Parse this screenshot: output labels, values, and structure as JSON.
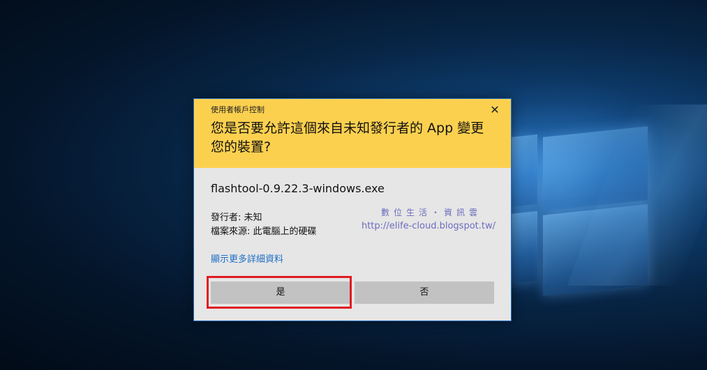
{
  "dialog": {
    "caption": "使用者帳戶控制",
    "close_symbol": "✕",
    "title": "您是否要允許這個來自未知發行者的 App 變更您的裝置?",
    "file_name": "flashtool-0.9.22.3-windows.exe",
    "publisher": "發行者: 未知",
    "origin": "檔案來源: 此電腦上的硬碟",
    "more_details_link": "顯示更多詳細資料",
    "yes_label": "是",
    "no_label": "否"
  },
  "watermark": {
    "title": "數位生活・資訊雲",
    "url": "http://elife-cloud.blogspot.tw/"
  },
  "colors": {
    "header_bg": "#fcd04f",
    "body_bg": "#e6e6e6",
    "button_bg": "#c2c2c2",
    "link": "#1f6ec4",
    "highlight": "#e21a22",
    "watermark": "#6c6cbf"
  }
}
